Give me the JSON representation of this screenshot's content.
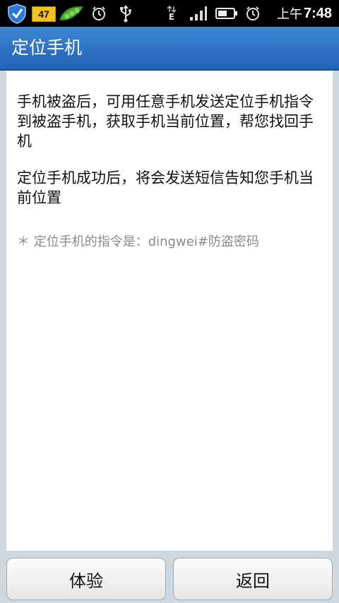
{
  "status_bar": {
    "battery_level_badge": "47",
    "ampm": "上午",
    "time": "7:48",
    "network_type": "E",
    "icons": [
      "shield-icon",
      "battery-47-icon",
      "pea-pod-icon",
      "alarm-icon",
      "usb-icon",
      "data-arrows-icon",
      "signal-icon",
      "battery-icon",
      "alarm-icon"
    ]
  },
  "titlebar": {
    "title": "定位手机"
  },
  "content": {
    "paragraph1": "手机被盗后，可用任意手机发送定位手机指令到被盗手机，获取手机当前位置，帮您找回手机",
    "paragraph2": "定位手机成功后，将会发送短信告知您手机当前位置",
    "hint": "＊ 定位手机的指令是：dingwei#防盗密码"
  },
  "buttons": {
    "try_label": "体验",
    "back_label": "返回"
  },
  "colors": {
    "titlebar": "#2f74c6",
    "background": "#cfd8df",
    "hint_text": "#8a8a8a"
  }
}
